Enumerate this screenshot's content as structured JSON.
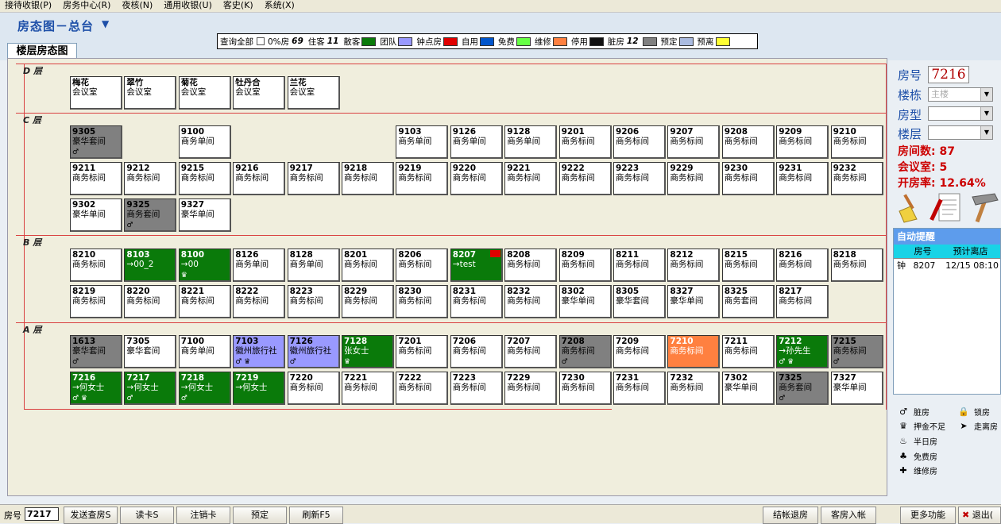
{
  "menu": [
    "接待收银(P)",
    "房务中心(R)",
    "夜核(N)",
    "通用收银(U)",
    "客史(K)",
    "系统(X)"
  ],
  "title": "房态图－总台",
  "tab_label": "楼层房态图",
  "legend": {
    "query_all": "查询全部",
    "items": [
      {
        "label": "0%房",
        "num": "69",
        "color": ""
      },
      {
        "label": "住客",
        "num": "11",
        "color": ""
      },
      {
        "label": "散客",
        "num": "",
        "color": "#0a7a0a"
      },
      {
        "label": "团队",
        "num": "",
        "color": "#9999ff"
      },
      {
        "label": "钟点房",
        "num": "",
        "color": "#e00000"
      },
      {
        "label": "自用",
        "num": "",
        "color": "#0055cc"
      },
      {
        "label": "免费",
        "num": "",
        "color": "#66ff44"
      },
      {
        "label": "维修",
        "num": "",
        "color": "#ff8040"
      },
      {
        "label": "停用",
        "num": "",
        "color": "#111111"
      },
      {
        "label": "脏房",
        "num": "12",
        "color": "#808080"
      },
      {
        "label": "预定",
        "num": "",
        "color": "#aabbe0"
      },
      {
        "label": "预离",
        "num": "",
        "color": "#ffff33"
      }
    ]
  },
  "floors": {
    "D": "D 层",
    "C": "C 层",
    "B": "B 层",
    "A": "A 层"
  },
  "rooms_D": [
    {
      "n": "梅花",
      "t": "会议室",
      "s": "w"
    },
    {
      "n": "翠竹",
      "t": "会议室",
      "s": "w"
    },
    {
      "n": "菊花",
      "t": "会议室",
      "s": "w"
    },
    {
      "n": "牡丹合",
      "t": "会议室",
      "s": "w"
    },
    {
      "n": "兰花",
      "t": "会议室",
      "s": "w"
    }
  ],
  "rooms_C1": [
    {
      "n": "9305",
      "t": "豪华套间",
      "s": "gr",
      "ic": "♂"
    },
    {
      "n": "9100",
      "t": "商务单间",
      "s": "w"
    },
    {
      "n": "9103",
      "t": "商务单间",
      "s": "w"
    },
    {
      "n": "9126",
      "t": "商务单间",
      "s": "w"
    },
    {
      "n": "9128",
      "t": "商务单间",
      "s": "w"
    },
    {
      "n": "9201",
      "t": "商务标间",
      "s": "w"
    },
    {
      "n": "9206",
      "t": "商务标间",
      "s": "w"
    },
    {
      "n": "9207",
      "t": "商务标间",
      "s": "w"
    },
    {
      "n": "9208",
      "t": "商务标间",
      "s": "w"
    },
    {
      "n": "9209",
      "t": "商务标间",
      "s": "w"
    },
    {
      "n": "9210",
      "t": "商务标间",
      "s": "w"
    }
  ],
  "rooms_C2": [
    {
      "n": "9211",
      "t": "商务标间",
      "s": "w"
    },
    {
      "n": "9212",
      "t": "商务标间",
      "s": "w"
    },
    {
      "n": "9215",
      "t": "商务标间",
      "s": "w"
    },
    {
      "n": "9216",
      "t": "商务标间",
      "s": "w"
    },
    {
      "n": "9217",
      "t": "商务标间",
      "s": "w"
    },
    {
      "n": "9218",
      "t": "商务标间",
      "s": "w"
    },
    {
      "n": "9219",
      "t": "商务标间",
      "s": "w"
    },
    {
      "n": "9220",
      "t": "商务标间",
      "s": "w"
    },
    {
      "n": "9221",
      "t": "商务标间",
      "s": "w"
    },
    {
      "n": "9222",
      "t": "商务标间",
      "s": "w"
    },
    {
      "n": "9223",
      "t": "商务标间",
      "s": "w"
    },
    {
      "n": "9229",
      "t": "商务标间",
      "s": "w"
    },
    {
      "n": "9230",
      "t": "商务标间",
      "s": "w"
    },
    {
      "n": "9231",
      "t": "商务标间",
      "s": "w"
    },
    {
      "n": "9232",
      "t": "商务标间",
      "s": "w"
    }
  ],
  "rooms_C3": [
    {
      "n": "9302",
      "t": "豪华单间",
      "s": "w"
    },
    {
      "n": "9325",
      "t": "商务套间",
      "s": "gr",
      "ic": "♂"
    },
    {
      "n": "9327",
      "t": "豪华单间",
      "s": "w"
    }
  ],
  "rooms_B1": [
    {
      "n": "8210",
      "t": "商务标间",
      "s": "w"
    },
    {
      "n": "8103",
      "t": "→00_2",
      "s": "g"
    },
    {
      "n": "8100",
      "t": "→00",
      "s": "g",
      "ic": "♛"
    },
    {
      "n": "8126",
      "t": "商务单间",
      "s": "w"
    },
    {
      "n": "8128",
      "t": "商务单间",
      "s": "w"
    },
    {
      "n": "8201",
      "t": "商务标间",
      "s": "w"
    },
    {
      "n": "8206",
      "t": "商务标间",
      "s": "w"
    },
    {
      "n": "8207",
      "t": "→test",
      "s": "g",
      "flag": "1"
    },
    {
      "n": "8208",
      "t": "商务标间",
      "s": "w"
    },
    {
      "n": "8209",
      "t": "商务标间",
      "s": "w"
    },
    {
      "n": "8211",
      "t": "商务标间",
      "s": "w"
    },
    {
      "n": "8212",
      "t": "商务标间",
      "s": "w"
    },
    {
      "n": "8215",
      "t": "商务标间",
      "s": "w"
    },
    {
      "n": "8216",
      "t": "商务标间",
      "s": "w"
    },
    {
      "n": "8218",
      "t": "商务标间",
      "s": "w"
    }
  ],
  "rooms_B2": [
    {
      "n": "8219",
      "t": "商务标间",
      "s": "w"
    },
    {
      "n": "8220",
      "t": "商务标间",
      "s": "w"
    },
    {
      "n": "8221",
      "t": "商务标间",
      "s": "w"
    },
    {
      "n": "8222",
      "t": "商务标间",
      "s": "w"
    },
    {
      "n": "8223",
      "t": "商务标间",
      "s": "w"
    },
    {
      "n": "8229",
      "t": "商务标间",
      "s": "w"
    },
    {
      "n": "8230",
      "t": "商务标间",
      "s": "w"
    },
    {
      "n": "8231",
      "t": "商务标间",
      "s": "w"
    },
    {
      "n": "8232",
      "t": "商务标间",
      "s": "w"
    },
    {
      "n": "8302",
      "t": "豪华单间",
      "s": "w"
    },
    {
      "n": "8305",
      "t": "豪华套间",
      "s": "w"
    },
    {
      "n": "8327",
      "t": "豪华单间",
      "s": "w"
    },
    {
      "n": "8325",
      "t": "商务套间",
      "s": "w"
    },
    {
      "n": "8217",
      "t": "商务标间",
      "s": "w"
    }
  ],
  "rooms_A1": [
    {
      "n": "1613",
      "t": "豪华套间",
      "s": "gr",
      "ic": "♂"
    },
    {
      "n": "7305",
      "t": "豪华套间",
      "s": "w"
    },
    {
      "n": "7100",
      "t": "商务单间",
      "s": "w"
    },
    {
      "n": "7103",
      "t": "徽州旅行社",
      "s": "pu",
      "ic": "♂ ♛"
    },
    {
      "n": "7126",
      "t": "徽州旅行社",
      "s": "pu",
      "ic": "♂"
    },
    {
      "n": "7128",
      "t": "张女士",
      "s": "g",
      "ic": "♛"
    },
    {
      "n": "7201",
      "t": "商务标间",
      "s": "w"
    },
    {
      "n": "7206",
      "t": "商务标间",
      "s": "w"
    },
    {
      "n": "7207",
      "t": "商务标间",
      "s": "w"
    },
    {
      "n": "7208",
      "t": "商务标间",
      "s": "gr",
      "ic": "♂"
    },
    {
      "n": "7209",
      "t": "商务标间",
      "s": "w"
    },
    {
      "n": "7210",
      "t": "商务标间",
      "s": "or"
    },
    {
      "n": "7211",
      "t": "商务标间",
      "s": "w"
    },
    {
      "n": "7212",
      "t": "→孙先生",
      "s": "g",
      "ic": "♂ ♛"
    },
    {
      "n": "7215",
      "t": "商务标间",
      "s": "gr",
      "ic": "♂"
    }
  ],
  "rooms_A2": [
    {
      "n": "7216",
      "t": "→何女士",
      "s": "g",
      "ic": "♂ ♛"
    },
    {
      "n": "7217",
      "t": "→何女士",
      "s": "g",
      "ic": "♂"
    },
    {
      "n": "7218",
      "t": "→何女士",
      "s": "g",
      "ic": "♂"
    },
    {
      "n": "7219",
      "t": "→何女士",
      "s": "g"
    },
    {
      "n": "7220",
      "t": "商务标间",
      "s": "w"
    },
    {
      "n": "7221",
      "t": "商务标间",
      "s": "w"
    },
    {
      "n": "7222",
      "t": "商务标间",
      "s": "w"
    },
    {
      "n": "7223",
      "t": "商务标间",
      "s": "w"
    },
    {
      "n": "7229",
      "t": "商务标间",
      "s": "w"
    },
    {
      "n": "7230",
      "t": "商务标间",
      "s": "w"
    },
    {
      "n": "7231",
      "t": "商务标间",
      "s": "w"
    },
    {
      "n": "7232",
      "t": "商务标间",
      "s": "w"
    },
    {
      "n": "7302",
      "t": "豪华单间",
      "s": "w"
    },
    {
      "n": "7325",
      "t": "商务套间",
      "s": "gr",
      "ic": "♂"
    },
    {
      "n": "7327",
      "t": "豪华单间",
      "s": "w"
    }
  ],
  "info": {
    "room_label": "房号",
    "room_value": "7216",
    "building_label": "楼栋",
    "building_value": "主楼",
    "type_label": "房型",
    "floor_label": "楼层",
    "room_count": "房间数: 87",
    "meeting_rooms": "会议室: 5",
    "occupancy": "开房率: 12.64%"
  },
  "reminder": {
    "title": "自动提醒",
    "cols": [
      "房号",
      "预计离店"
    ],
    "rows": [
      {
        "icon": "钟",
        "room": "8207",
        "time": "12/15 08:10"
      }
    ]
  },
  "icon_legend": [
    {
      "g": "♂",
      "l": "脏房"
    },
    {
      "g": "🔒",
      "l": "锁房"
    },
    {
      "g": "♛",
      "l": "押金不足"
    },
    {
      "g": "➤",
      "l": "走离房"
    },
    {
      "g": "♨",
      "l": "半日房"
    },
    {
      "g": "♣",
      "l": "免费房"
    },
    {
      "g": "✚",
      "l": "维修房"
    }
  ],
  "bottom": {
    "room_label": "房号",
    "room_value": "7217",
    "buttons": [
      "发送查房S",
      "读卡S",
      "注销卡",
      "预定",
      "刷新F5",
      "结帐退房",
      "客房入帐",
      "更多功能",
      "退出("
    ]
  }
}
